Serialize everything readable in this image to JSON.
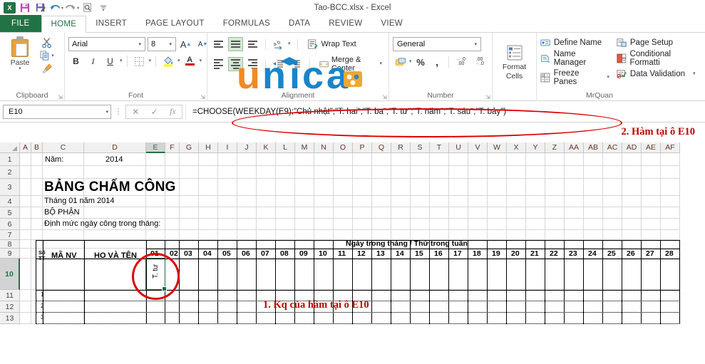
{
  "window": {
    "title": "Tao-BCC.xlsx - Excel",
    "quick_access": [
      {
        "name": "excel-logo",
        "glyph": "X"
      },
      {
        "name": "save-icon",
        "glyph": "💾"
      },
      {
        "name": "save-as-icon",
        "glyph": "📝"
      },
      {
        "name": "undo-icon",
        "glyph": "↶"
      },
      {
        "name": "redo-icon",
        "glyph": "↷"
      },
      {
        "name": "print-preview-icon",
        "glyph": "🔍"
      },
      {
        "name": "customize-qat-icon",
        "glyph": "≡"
      }
    ]
  },
  "ribbon": {
    "tabs": [
      {
        "label": "FILE",
        "id": "file"
      },
      {
        "label": "HOME",
        "id": "home"
      },
      {
        "label": "INSERT",
        "id": "insert"
      },
      {
        "label": "PAGE LAYOUT",
        "id": "page-layout"
      },
      {
        "label": "FORMULAS",
        "id": "formulas"
      },
      {
        "label": "DATA",
        "id": "data"
      },
      {
        "label": "REVIEW",
        "id": "review"
      },
      {
        "label": "VIEW",
        "id": "view"
      }
    ],
    "active_tab": "HOME",
    "groups": {
      "clipboard": {
        "label": "Clipboard",
        "paste_label": "Paste",
        "cut_icon": "✂",
        "copy_icon": "⧉",
        "format_painter_icon": "🖌"
      },
      "font": {
        "label": "Font",
        "font_name": "Arial",
        "font_size": "8",
        "grow_font": "A",
        "shrink_font": "A",
        "bold": "B",
        "italic": "I",
        "underline": "U",
        "borders_icon": "border-icon",
        "fill_color_icon": "fill-icon",
        "font_color": "A"
      },
      "alignment": {
        "label": "Alignment",
        "wrap_text": "Wrap Text",
        "merge_center": "Merge & Center",
        "orientation_icon": "orientation-icon",
        "decrease_indent": "⇤",
        "increase_indent": "⇥"
      },
      "number": {
        "label": "Number",
        "format": "General",
        "percent": "%",
        "comma": ",",
        "increase_decimal": ".00",
        "decrease_decimal": ".00"
      },
      "cells": {
        "label": "",
        "format_cells_line1": "Format",
        "format_cells_line2": "Cells"
      },
      "mrquan": {
        "label": "MrQuan",
        "items": [
          {
            "label": "Define Name",
            "icon": "define-name-icon"
          },
          {
            "label": "Name Manager",
            "icon": "name-manager-icon"
          },
          {
            "label": "Freeze Panes",
            "icon": "freeze-panes-icon",
            "dropdown": true
          },
          {
            "label": "Page Setup",
            "icon": "page-setup-icon"
          },
          {
            "label": "Conditional Formatti",
            "icon": "conditional-formatting-icon"
          },
          {
            "label": "Data Validation",
            "icon": "data-validation-icon",
            "dropdown": true
          }
        ]
      }
    }
  },
  "formula_bar": {
    "name_box": "E10",
    "cancel_icon": "✕",
    "enter_icon": "✓",
    "function_icon": "fx",
    "formula": "=CHOOSE(WEEKDAY(E9);\"Chủ nhật\";\"T. hai\";\"T. ba\";\"T. tư\";\"T. năm\";\"T. sáu\";\"T. bảy\")"
  },
  "annotations": [
    {
      "id": "anno1",
      "text": "1. Kq của hàm tại ô E10"
    },
    {
      "id": "anno2",
      "text": "2. Hàm tại ô E10"
    }
  ],
  "sheet": {
    "columns": [
      "A",
      "B",
      "C",
      "D",
      "E",
      "F",
      "G",
      "H",
      "I",
      "J",
      "K",
      "L",
      "M",
      "N",
      "O",
      "P",
      "Q",
      "R",
      "S",
      "T",
      "U",
      "V",
      "W",
      "X",
      "Y",
      "Z",
      "AA",
      "AB",
      "AC",
      "AD",
      "AE",
      "AF"
    ],
    "selected_column": "E",
    "rows": [
      "1",
      "2",
      "3",
      "4",
      "5",
      "6",
      "7",
      "8",
      "9",
      "10",
      "11",
      "12",
      "13"
    ],
    "selected_row": "10",
    "selected_cell": "E10",
    "selected_cell_value": "T. tư",
    "cells": {
      "C1": "Năm:",
      "D1": "2014",
      "C3": "BẢNG CHẤM CÔNG",
      "C4": "Tháng 01 năm 2014",
      "C5": "BỘ PHẬN",
      "C6": "Định mức ngày công trong tháng:",
      "header_banner": "Ngày trong tháng / Thứ trong tuần",
      "col_stt_line1": "Số",
      "col_stt_line2": "TT",
      "col_manv": "MÃ NV",
      "col_hovaten": "HỌ VÀ TÊN"
    },
    "day_numbers": [
      "01",
      "02",
      "03",
      "04",
      "05",
      "06",
      "07",
      "08",
      "09",
      "10",
      "11",
      "12",
      "13",
      "14",
      "15",
      "16",
      "17",
      "18",
      "19",
      "20",
      "21",
      "22",
      "23",
      "24",
      "25",
      "26",
      "27",
      "28"
    ],
    "stt_values": [
      "1",
      "2",
      "3"
    ]
  },
  "watermark": {
    "text": "unica",
    "colors": {
      "orange": "#F08A24",
      "blue": "#1B84C8"
    }
  },
  "colors": {
    "accent_green": "#217346",
    "annotation_red": "#C00000",
    "ellipse_red": "#DD0000",
    "selection_green": "#1E6B41"
  }
}
